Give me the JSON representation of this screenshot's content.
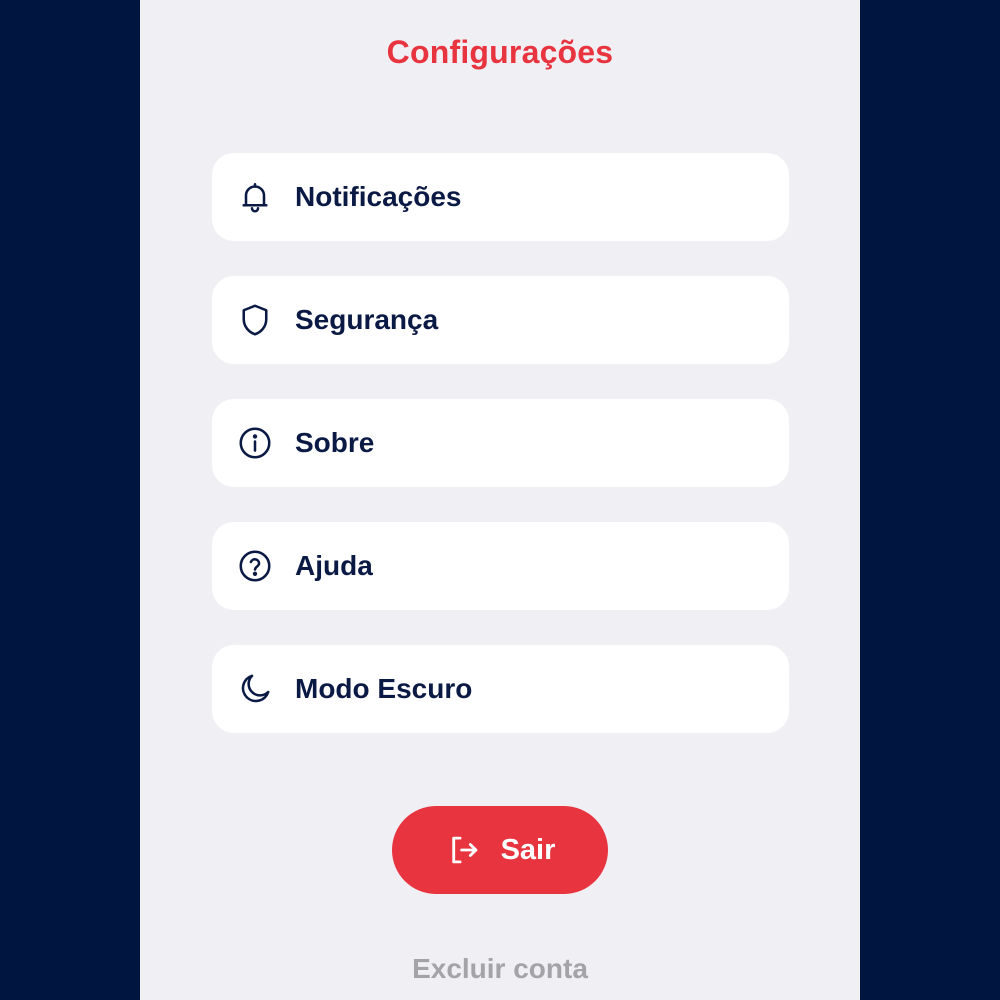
{
  "header": {
    "title": "Configurações"
  },
  "menu": {
    "items": [
      {
        "label": "Notificações",
        "icon": "bell-icon"
      },
      {
        "label": "Segurança",
        "icon": "shield-icon"
      },
      {
        "label": "Sobre",
        "icon": "info-icon"
      },
      {
        "label": "Ajuda",
        "icon": "help-icon"
      },
      {
        "label": "Modo Escuro",
        "icon": "moon-icon"
      }
    ]
  },
  "logout": {
    "label": "Sair",
    "icon": "logout-icon"
  },
  "delete_account": {
    "label": "Excluir conta"
  },
  "colors": {
    "outer_background": "#001640",
    "screen_background": "#f0eff4",
    "accent_red": "#e8343e",
    "text_navy": "#0b1a44",
    "muted_gray": "#a3a3a8",
    "card_background": "#ffffff"
  }
}
